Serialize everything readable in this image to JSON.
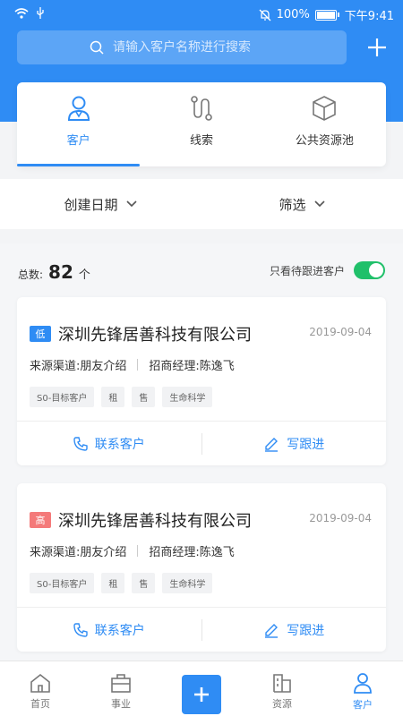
{
  "status_bar": {
    "battery": "100%",
    "time": "下午9:41"
  },
  "search": {
    "placeholder": "请输入客户名称进行搜索"
  },
  "tabs": [
    {
      "label": "客户",
      "icon": "person-icon",
      "active": true
    },
    {
      "label": "线索",
      "icon": "route-icon",
      "active": false
    },
    {
      "label": "公共资源池",
      "icon": "cube-icon",
      "active": false
    }
  ],
  "filters": {
    "date_label": "创建日期",
    "filter_label": "筛选"
  },
  "summary": {
    "total_label": "总数:",
    "total_value": "82",
    "total_unit": "个",
    "follow_label": "只看待跟进客户",
    "follow_enabled": true
  },
  "customers": [
    {
      "level": "低",
      "level_color": "#2f8cf4",
      "name": "深圳先锋居善科技有限公司",
      "date": "2019-09-04",
      "source": "来源渠道:朋友介绍",
      "manager": "招商经理:陈逸飞",
      "tags": [
        "S0-目标客户",
        "租",
        "售",
        "生命科学"
      ],
      "contact_label": "联系客户",
      "follow_label": "写跟进"
    },
    {
      "level": "高",
      "level_color": "#f47a7a",
      "name": "深圳先锋居善科技有限公司",
      "date": "2019-09-04",
      "source": "来源渠道:朋友介绍",
      "manager": "招商经理:陈逸飞",
      "tags": [
        "S0-目标客户",
        "租",
        "售",
        "生命科学"
      ],
      "contact_label": "联系客户",
      "follow_label": "写跟进"
    }
  ],
  "bottom_nav": [
    {
      "label": "首页",
      "icon": "home-icon",
      "active": false
    },
    {
      "label": "事业",
      "icon": "briefcase-icon",
      "active": false
    },
    {
      "label": "",
      "icon": "plus-icon",
      "active": false
    },
    {
      "label": "资源",
      "icon": "building-icon",
      "active": false
    },
    {
      "label": "客户",
      "icon": "person-icon",
      "active": true
    }
  ],
  "colors": {
    "primary": "#2f8cf4",
    "toggle_on": "#20c06a"
  }
}
